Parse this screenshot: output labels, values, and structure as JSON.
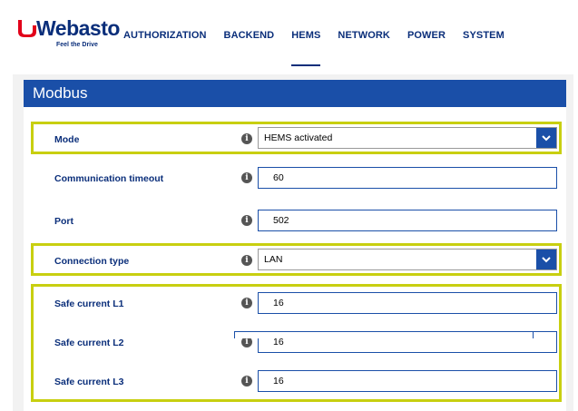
{
  "brand": {
    "name": "Webasto",
    "tagline": "Feel the Drive",
    "colors": {
      "primary": "#0a2e7a",
      "accent": "#1a4fa8",
      "highlight": "#c8cf10",
      "logo_red": "#e2001a"
    }
  },
  "nav": {
    "items": [
      {
        "label": "AUTHORIZATION"
      },
      {
        "label": "BACKEND"
      },
      {
        "label": "HEMS"
      },
      {
        "label": "NETWORK"
      },
      {
        "label": "POWER"
      },
      {
        "label": "SYSTEM"
      }
    ],
    "active": "HEMS"
  },
  "panel": {
    "title": "Modbus",
    "fields": {
      "mode": {
        "label": "Mode",
        "value": "HEMS activated",
        "type": "select"
      },
      "timeout": {
        "label": "Communication timeout",
        "value": "60",
        "type": "input"
      },
      "port": {
        "label": "Port",
        "value": "502",
        "type": "input"
      },
      "connection": {
        "label": "Connection type",
        "value": "LAN",
        "type": "select"
      },
      "l1": {
        "label": "Safe current L1",
        "value": "16",
        "type": "input"
      },
      "l2": {
        "label": "Safe current L2",
        "value": "16",
        "type": "input"
      },
      "l3": {
        "label": "Safe current L3",
        "value": "16",
        "type": "input"
      }
    },
    "info_icon": "info-icon",
    "chevron_icon": "chevron-down-icon"
  }
}
